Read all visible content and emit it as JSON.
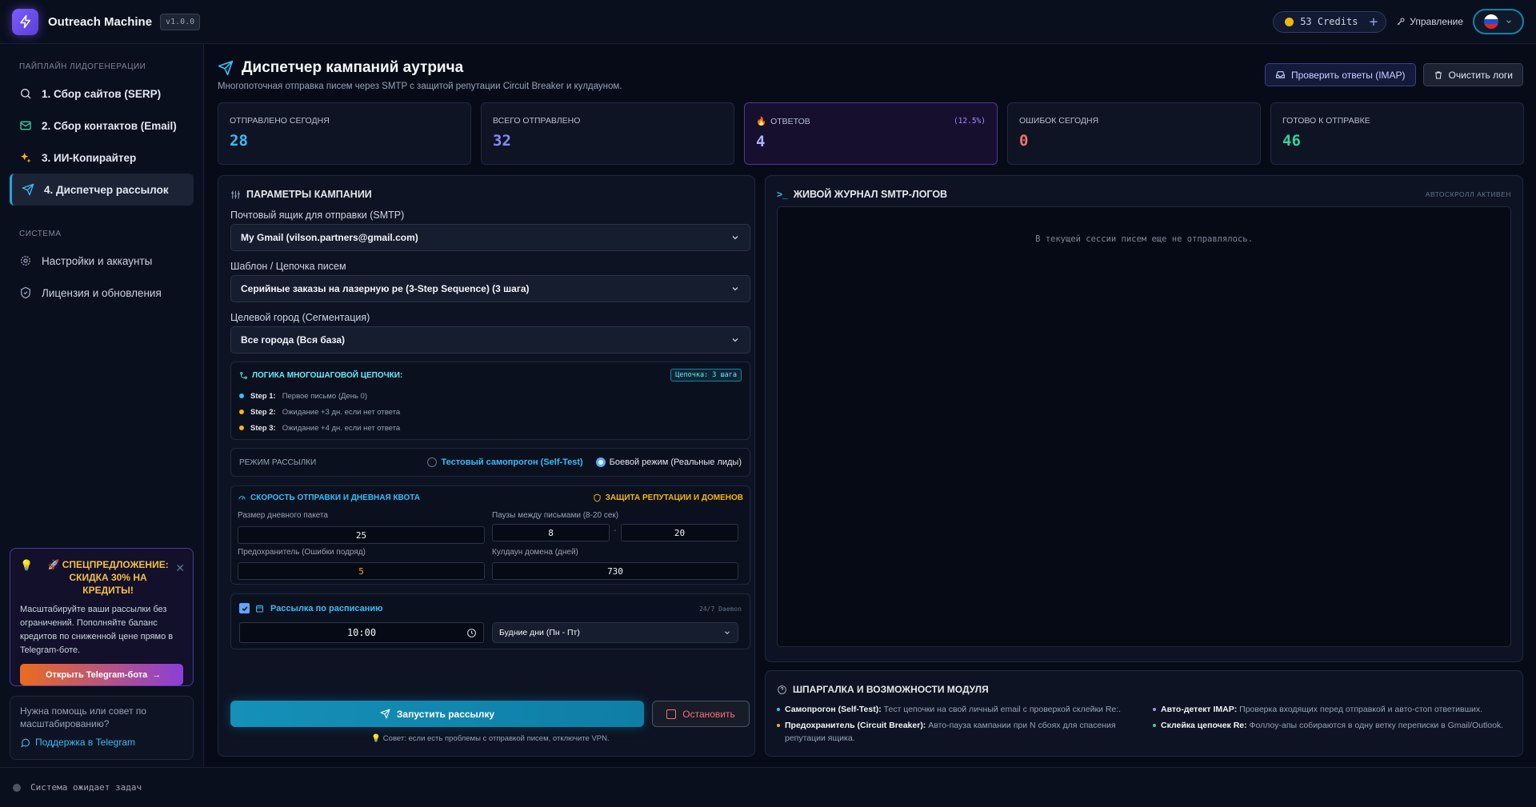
{
  "app": {
    "title": "Outreach Machine",
    "version": "v1.0.0"
  },
  "header": {
    "credits": "53 Credits",
    "manage": "Управление"
  },
  "sidebar": {
    "section_pipeline": "ПАЙПЛАЙН ЛИДОГЕНЕРАЦИИ",
    "items": [
      {
        "label": "1. Сбор сайтов (SERP)"
      },
      {
        "label": "2. Сбор контактов (Email)"
      },
      {
        "label": "3. ИИ-Копирайтер"
      },
      {
        "label": "4. Диспетчер рассылок"
      }
    ],
    "section_system": "СИСТЕМА",
    "system_items": [
      {
        "label": "Настройки и аккаунты"
      },
      {
        "label": "Лицензия и обновления"
      }
    ],
    "promo": {
      "title": "🚀 СПЕЦПРЕДЛОЖЕНИЕ: СКИДКА 30% НА КРЕДИТЫ!",
      "text": "Масштабируйте ваши рассылки без ограничений. Пополняйте баланс кредитов по сниженной цене прямо в Telegram-боте.",
      "button": "Открыть Telegram-бота"
    },
    "help": {
      "text": "Нужна помощь или совет по масштабированию?",
      "link": "Поддержка в Telegram"
    }
  },
  "statusbar": {
    "text": "Система ожидает задач"
  },
  "page": {
    "title": "Диспетчер кампаний аутрича",
    "subtitle": "Многопоточная отправка писем через SMTP с защитой репутации Circuit Breaker и кулдауном.",
    "btn_imap": "Проверить ответы (IMAP)",
    "btn_clear": "Очистить логи"
  },
  "stats": [
    {
      "label": "ОТПРАВЛЕНО СЕГОДНЯ",
      "value": "28",
      "color": "#38bdf8"
    },
    {
      "label": "ВСЕГО ОТПРАВЛЕНО",
      "value": "32",
      "color": "#818cf8"
    },
    {
      "label": "ОТВЕТОВ",
      "value": "4",
      "pct": "(12.5%)",
      "color": "#a5b4fc"
    },
    {
      "label": "ОШИБОК СЕГОДНЯ",
      "value": "0",
      "color": "#f87171"
    },
    {
      "label": "ГОТОВО К ОТПРАВКЕ",
      "value": "46",
      "color": "#34d399"
    }
  ],
  "campaign": {
    "title": "ПАРАМЕТРЫ КАМПАНИИ",
    "smtp_label": "Почтовый ящик для отправки (SMTP)",
    "smtp_value": "My Gmail (vilson.partners@gmail.com)",
    "template_label": "Шаблон / Цепочка писем",
    "template_value": "Серийные заказы на лазерную ре (3-Step Sequence) (3 шага)",
    "city_label": "Целевой город (Сегментация)",
    "city_value": "Все города (Вся база)",
    "chain": {
      "title": "ЛОГИКА МНОГОШАГОВОЙ ЦЕПОЧКИ:",
      "badge": "Цепочка: 3 шага",
      "steps": [
        {
          "name": "Step 1:",
          "desc": "Первое письмо (День 0)"
        },
        {
          "name": "Step 2:",
          "desc": "Ожидание +3 дн. если нет ответа"
        },
        {
          "name": "Step 3:",
          "desc": "Ожидание +4 дн. если нет ответа"
        }
      ]
    },
    "mode": {
      "label": "РЕЖИМ РАССЫЛКИ",
      "test": "Тестовый самопрогон (Self-Test)",
      "live": "Боевой режим (Реальные лиды)"
    },
    "speed": {
      "title": "СКОРОСТЬ ОТПРАВКИ И ДНЕВНАЯ КВОТА",
      "protect": "ЗАЩИТА РЕПУТАЦИИ И ДОМЕНОВ",
      "batch_label": "Размер дневного пакета",
      "batch_value": "25",
      "pause_label": "Паузы между письмами (8-20 сек)",
      "pause_min": "8",
      "pause_sep": "-",
      "pause_max": "20",
      "fuse_label": "Предохранитель (Ошибки подряд)",
      "fuse_value": "5",
      "cooldown_label": "Кулдаун домена (дней)",
      "cooldown_value": "730"
    },
    "schedule": {
      "label": "Рассылка по расписанию",
      "daemon": "24/7 Daemon",
      "time": "10:00",
      "days": "Будние дни (Пн - Пт)"
    },
    "btn_start": "Запустить рассылку",
    "btn_stop": "Остановить",
    "tip": "💡 Совет: если есть проблемы с отправкой писем, отключите VPN."
  },
  "log": {
    "title": "ЖИВОЙ ЖУРНАЛ SMTP-ЛОГОВ",
    "autoscroll": "АВТОСКРОЛЛ АКТИВЕН",
    "empty": "В текущей сессии писем еще не отправлялось."
  },
  "cheatsheet": {
    "title": "ШПАРГАЛКА И ВОЗМОЖНОСТИ МОДУЛЯ",
    "items": [
      {
        "name": "Самопрогон (Self-Test):",
        "desc": "Тест цепочки на свой личный email с проверкой склейки Re:.",
        "color": "#38bdf8"
      },
      {
        "name": "Авто-детект IMAP:",
        "desc": "Проверка входящих перед отправкой и авто-стоп ответивших.",
        "color": "#a78bfa"
      },
      {
        "name": "Предохранитель (Circuit Breaker):",
        "desc": "Авто-пауза кампании при N сбоях для спасения репутации ящика.",
        "color": "#f5b50a"
      },
      {
        "name": "Склейка цепочек Re:",
        "desc": "Фоллоу-апы собираются в одну ветку переписки в Gmail/Outlook.",
        "color": "#34d399"
      }
    ]
  }
}
